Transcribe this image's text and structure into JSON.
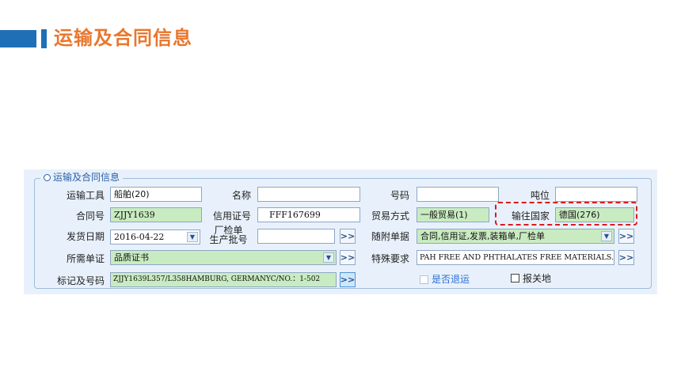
{
  "slide": {
    "title": "运输及合同信息"
  },
  "section": {
    "legend": "运输及合同信息"
  },
  "fields": {
    "transport": {
      "label": "运输工具",
      "value": "船舶(20)"
    },
    "name": {
      "label": "名称",
      "value": ""
    },
    "number": {
      "label": "号码",
      "value": ""
    },
    "berth": {
      "label": "吨位",
      "value": ""
    },
    "contract": {
      "label": "合同号",
      "value": "ZJJY1639"
    },
    "credit": {
      "label": "信用证号",
      "value": "FFF167699"
    },
    "trade": {
      "label": "贸易方式",
      "value": "一般贸易(1)"
    },
    "country": {
      "label": "输往国家",
      "value": "德国(276)"
    },
    "ship_date": {
      "label": "发货日期",
      "value": "2016-04-22"
    },
    "batch": {
      "label_line1": "厂检单",
      "label_line2": "生产批号",
      "value": ""
    },
    "docs": {
      "label": "随附单据",
      "value": "合同,信用证,发票,装箱单,厂检单"
    },
    "certs": {
      "label": "所需单证",
      "value": "品质证书"
    },
    "special": {
      "label": "特殊要求",
      "value": "PAH FREE AND PHTHALATES FREE MATERIALS."
    },
    "marks": {
      "label": "标记及号码",
      "value": "ZJJY1639L357/L358HAMBURG, GERMANYC/NO.：1-502"
    }
  },
  "checkboxes": {
    "returned": {
      "label": "是否退运",
      "checked": false,
      "disabled": true
    },
    "customs_place": {
      "label": "报关地",
      "checked": false
    }
  },
  "buttons": {
    "more": ">>"
  },
  "colors": {
    "accent": "#1f6fb6",
    "title": "#e8772e",
    "highlight": "#d91c1c",
    "field_green": "#c9ebc1"
  }
}
